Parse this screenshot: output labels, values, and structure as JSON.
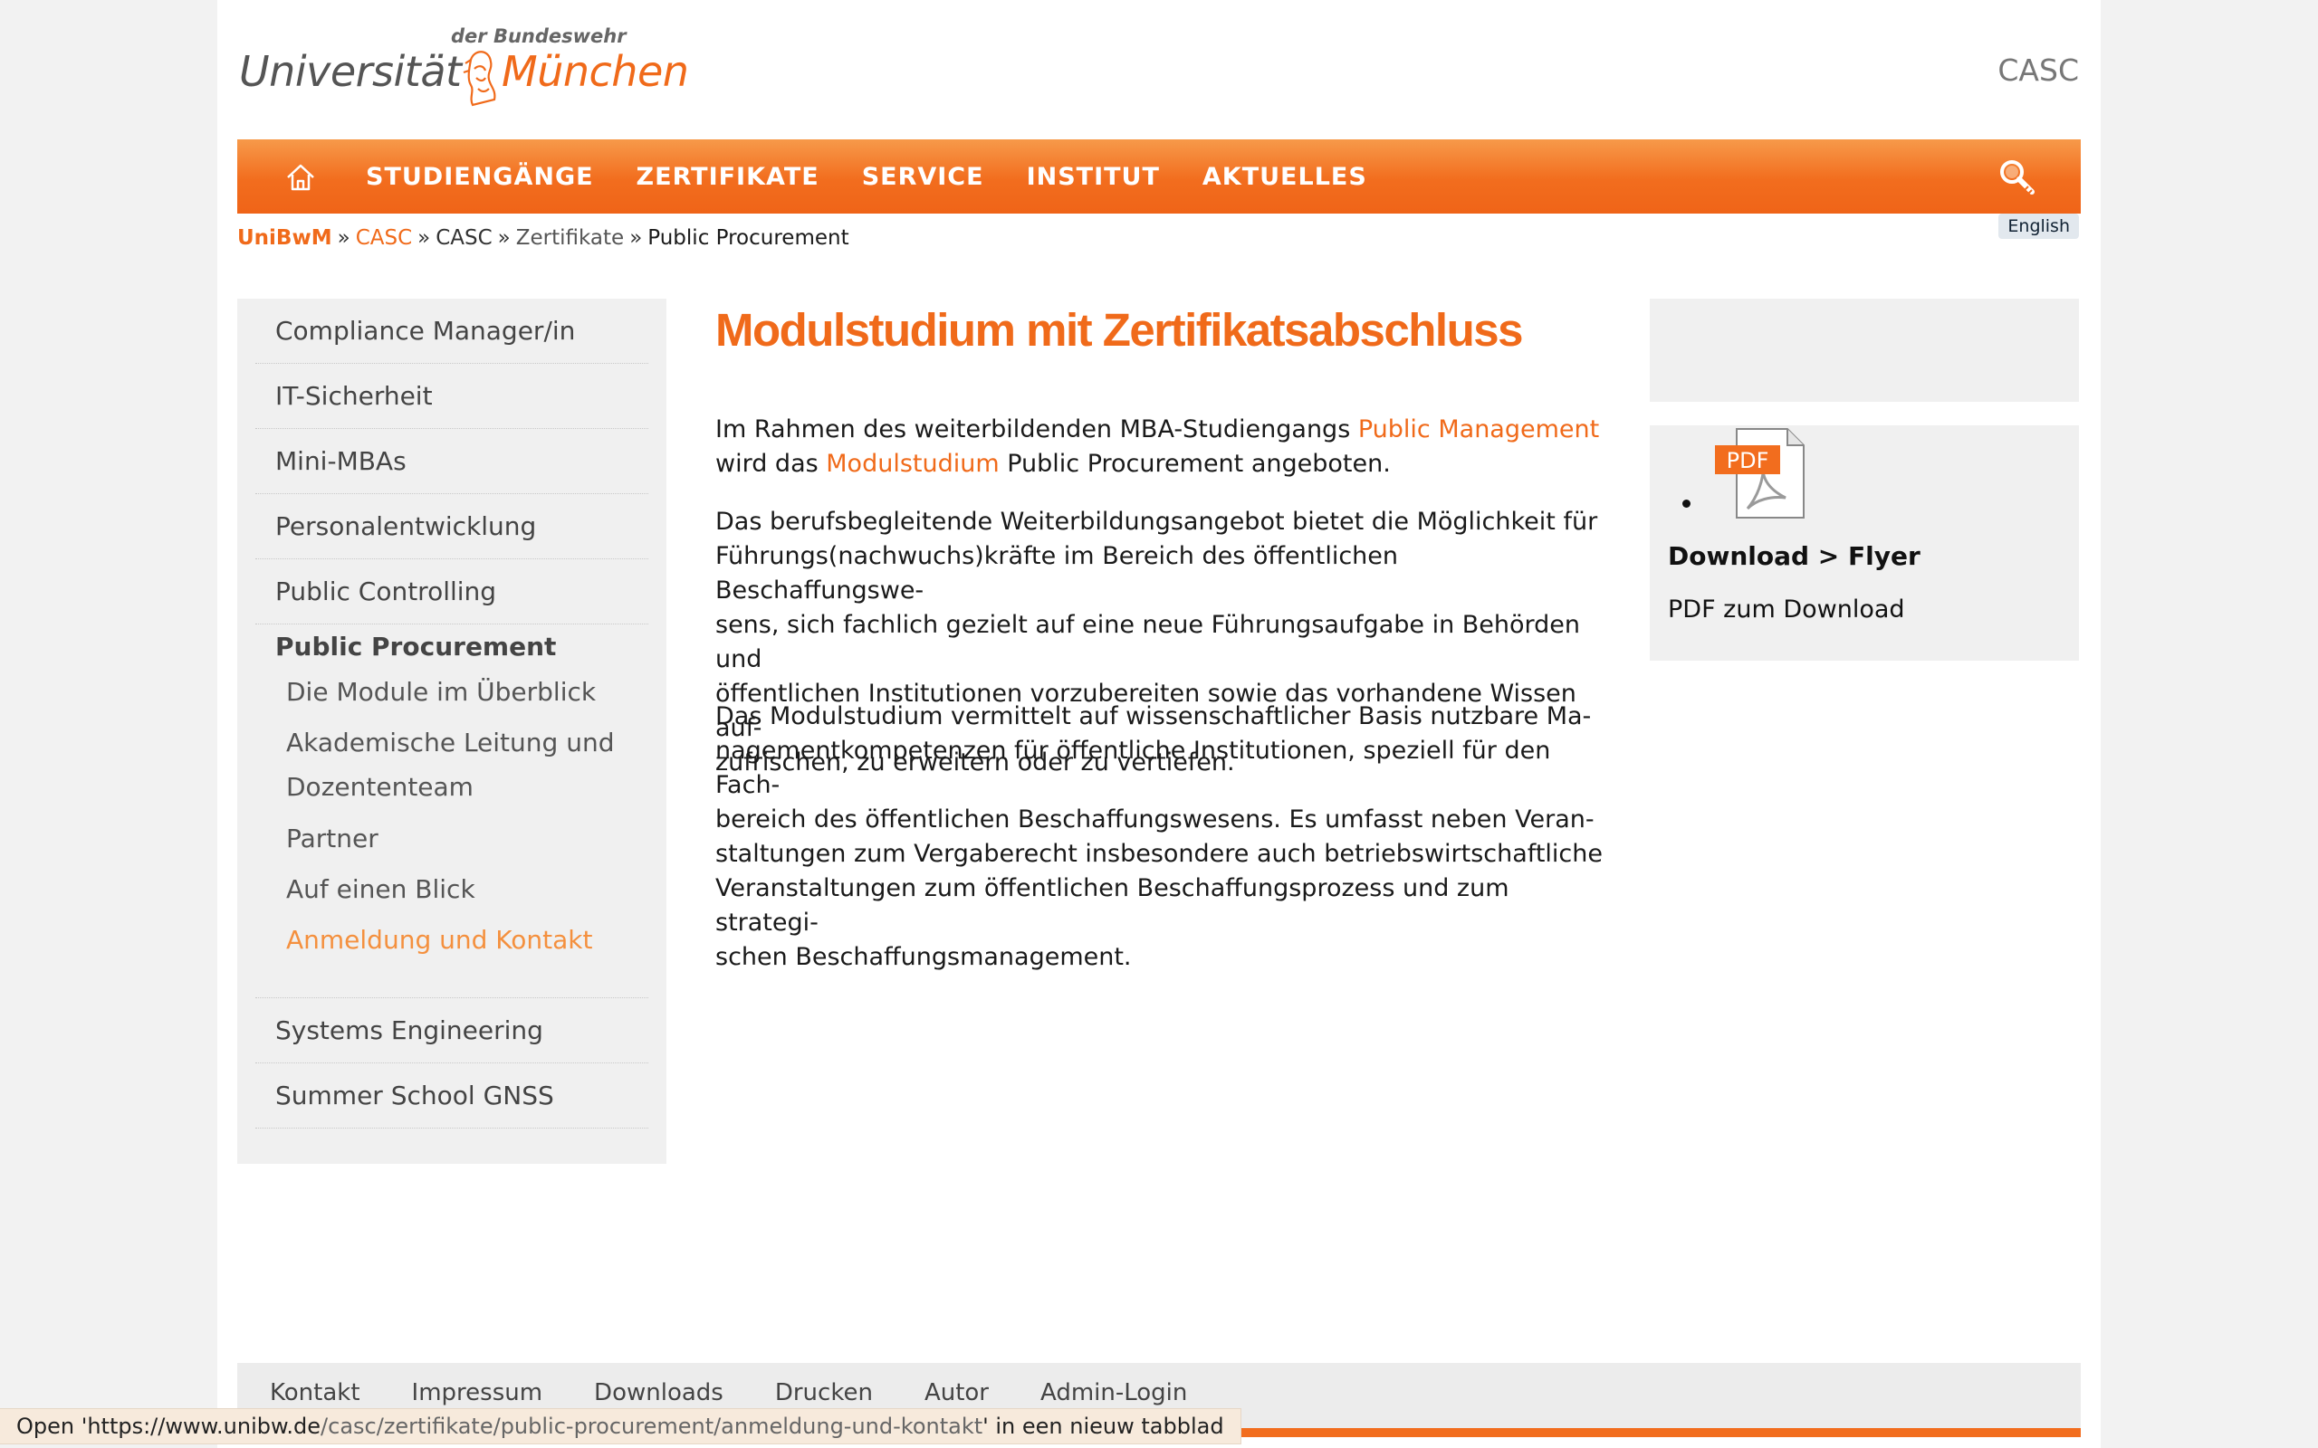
{
  "header": {
    "logo_small": "der Bundeswehr",
    "logo_uni": "Universität",
    "logo_city": "München",
    "site_name": "CASC"
  },
  "nav": {
    "items": [
      "STUDIENGÄNGE",
      "ZERTIFIKATE",
      "SERVICE",
      "INSTITUT",
      "AKTUELLES"
    ]
  },
  "breadcrumb": {
    "items": [
      "UniBwM",
      "CASC",
      "CASC",
      "Zertifikate",
      "Public Procurement"
    ],
    "separator": "»"
  },
  "language": "English",
  "sidebar": {
    "items_top": [
      "Compliance Manager/in",
      "IT-Sicherheit",
      "Mini-MBAs",
      "Personalentwicklung",
      "Public Controlling"
    ],
    "active": "Public Procurement",
    "subitems": [
      "Die Module im Überblick",
      "Akademische Leitung und",
      "Dozententeam",
      "Partner",
      "Auf einen Blick",
      "Anmeldung und Kontakt"
    ],
    "items_bottom": [
      "Systems Engineering",
      "Summer School GNSS"
    ]
  },
  "main": {
    "title": "Modulstudium mit Zertifikatsabschluss",
    "p1_a": "Im Rahmen des weiterbildenden MBA-Studiengangs ",
    "p1_link1": "Public Management",
    "p1_b": "wird das ",
    "p1_link2": "Modulstudium",
    "p1_c": " Public Procurement angeboten.",
    "p2": [
      "Das berufsbegleitende Weiterbildungsangebot bietet die Möglichkeit für",
      "Führungs(nachwuchs)kräfte im Bereich des öffentlichen Beschaffungswe-",
      "sens, sich fachlich gezielt auf eine neue Führungsaufgabe in Behörden und",
      "öffentlichen Institutionen vorzubereiten sowie das vorhandene Wissen auf-",
      "zufrischen, zu erweitern oder zu vertiefen."
    ],
    "p3": [
      "Das Modulstudium vermittelt auf wissenschaftlicher Basis nutzbare Ma-",
      "nagementkompetenzen für öffentliche Institutionen, speziell für den Fach-",
      "bereich des öffentlichen Beschaffungswesens. Es umfasst neben Veran-",
      "staltungen zum Vergaberecht insbesondere auch betriebswirtschaftliche",
      "Veranstaltungen zum öffentlichen Beschaffungsprozess und zum strategi-",
      "schen Beschaffungsmanagement."
    ]
  },
  "download": {
    "icon_label": "PDF",
    "title": "Download > Flyer",
    "description": "PDF zum Download"
  },
  "footer": {
    "links": [
      "Kontakt",
      "Impressum",
      "Downloads",
      "Drucken",
      "Autor",
      "Admin-Login"
    ]
  },
  "statusbar": {
    "prefix": "Open '",
    "host": "https://www.unibw.de",
    "path": "/casc/zertifikate/public-procurement/anmeldung-und-kontakt",
    "suffix": "' in een nieuw tabblad"
  },
  "colors": {
    "accent": "#f06a1a",
    "nav_top": "#f79a4a",
    "nav_bottom": "#ef6418",
    "sidebar_bg": "#f0f0f0",
    "page_bg": "#f2f2f2"
  }
}
